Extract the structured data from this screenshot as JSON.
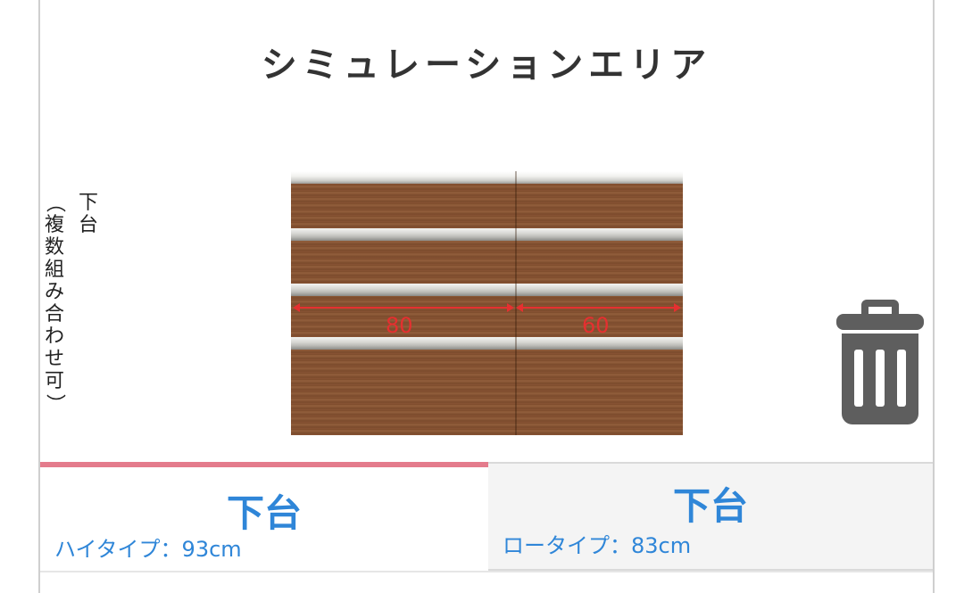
{
  "area": {
    "title": "シミュレーションエリア"
  },
  "side_label": {
    "main": [
      "下",
      "台"
    ],
    "sub": [
      "（",
      "複",
      "数",
      "組",
      "み",
      "合",
      "わ",
      "せ",
      "可",
      "）"
    ]
  },
  "cabinet": {
    "widths": [
      {
        "value": "80"
      },
      {
        "value": "60"
      }
    ],
    "dimension_color": "#e53030"
  },
  "delete": {
    "icon": "trash-icon"
  },
  "tabs": [
    {
      "title": "下台",
      "subtitle": "ハイタイプ：93cm",
      "active": true
    },
    {
      "title": "下台",
      "subtitle": "ロータイプ：83cm",
      "active": false
    }
  ],
  "colors": {
    "accent": "#2f86d8",
    "active_tab_bar": "#e47b8c"
  }
}
